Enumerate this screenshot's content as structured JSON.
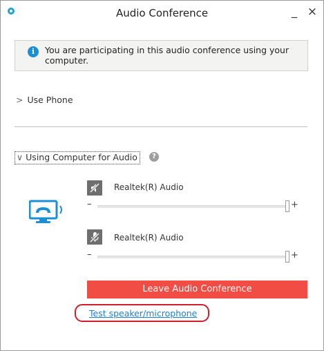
{
  "window": {
    "title": "Audio Conference",
    "minimize_glyph": "_",
    "close_glyph": "×"
  },
  "info": {
    "icon": "info-icon",
    "icon_glyph": "i",
    "text": "You are participating in this audio conference using your computer."
  },
  "use_phone": {
    "chevron": ">",
    "label": "Use Phone"
  },
  "using_computer": {
    "chevron": "∨",
    "label": "Using Computer for Audio",
    "help_glyph": "?"
  },
  "speaker": {
    "icon": "speaker-muted-icon",
    "device": "Realtek(R) Audio",
    "minus": "–",
    "plus": "+",
    "volume_percent": 100
  },
  "microphone": {
    "icon": "microphone-muted-icon",
    "device": "Realtek(R) Audio",
    "minus": "–",
    "plus": "+",
    "volume_percent": 100
  },
  "actions": {
    "leave_label": "Leave Audio Conference",
    "test_link_label": "Test speaker/microphone"
  },
  "colors": {
    "accent_blue": "#1a8fd6",
    "leave_red": "#f14d44",
    "highlight_red": "#d31d2a"
  }
}
